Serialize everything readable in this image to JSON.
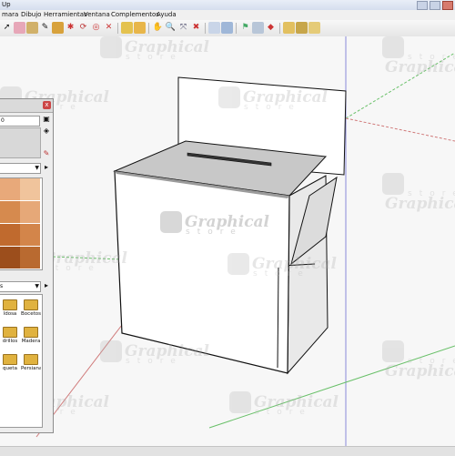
{
  "window": {
    "title": "Up"
  },
  "menu": [
    "mara",
    "Dibujo",
    "Herramientas",
    "Ventana",
    "Complementos",
    "Ayuda"
  ],
  "toolbar": {
    "icons": [
      "select-icon",
      "eraser-icon",
      "paint-bucket-icon",
      "line-icon",
      "pushpull-icon",
      "rotate-icon",
      "followme-icon",
      "offset-icon",
      "scale-icon",
      "move-icon",
      "orbit-icon",
      "pan-icon",
      "zoom-icon",
      "zoom-window-icon",
      "zoom-extents-icon",
      "section-icon",
      "component-icon",
      "group-icon",
      "walk-icon",
      "camera-icon",
      "shadow-icon",
      "fog-icon",
      "style-icon",
      "xray-icon"
    ]
  },
  "watermark": {
    "top": "Graphical",
    "bottom": "store"
  },
  "panel": {
    "name_value": "0",
    "materials_select": "s",
    "close_label": "x",
    "materials": [
      {
        "label": "ldosa"
      },
      {
        "label": "Bocetos"
      },
      {
        "label": "drillos"
      },
      {
        "label": "Madera"
      },
      {
        "label": "queta"
      },
      {
        "label": "Persiana"
      }
    ],
    "swatch_colors": [
      "#e8a97a",
      "#f0c49c",
      "#d68a4e",
      "#e6a878",
      "#c06a2e",
      "#d3854a",
      "#9c4e1c",
      "#b96a30"
    ]
  },
  "colors": {
    "axis_red": "#d07a7a",
    "axis_green": "#69c069",
    "axis_blue": "#8a8ad8",
    "box_face": "#ffffff",
    "box_top": "#c8c8c8",
    "box_side": "#e6e6e6"
  }
}
